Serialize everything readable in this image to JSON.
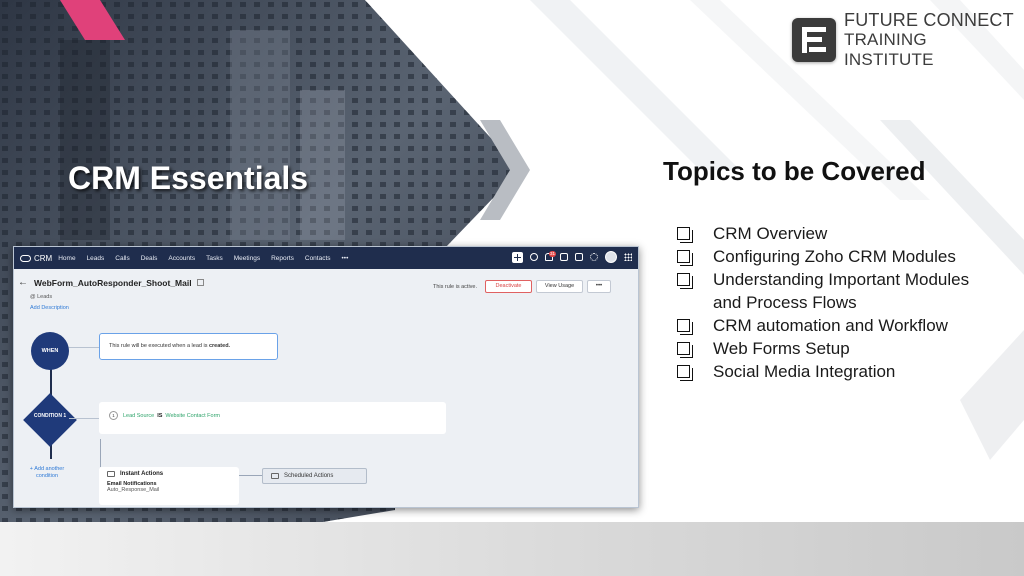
{
  "logo": {
    "line1": "FUTURE CONNECT",
    "line2": "TRAINING INSTITUTE"
  },
  "slide": {
    "title": "CRM Essentials",
    "topics_title": "Topics to be Covered",
    "topics": [
      "CRM Overview",
      "Configuring Zoho CRM Modules",
      "Understanding Important Modules and Process Flows",
      "CRM automation and Workflow",
      "Web Forms Setup",
      "Social Media Integration"
    ]
  },
  "crm": {
    "brand": "CRM",
    "nav": [
      "Home",
      "Leads",
      "Calls",
      "Deals",
      "Accounts",
      "Tasks",
      "Meetings",
      "Reports",
      "Contacts",
      "•••"
    ],
    "notification_count": "31",
    "rule_name": "WebForm_AutoResponder_Shoot_Mail",
    "module": "@ Leads",
    "add_description": "Add Description",
    "status_text": "This rule is active.",
    "deactivate_label": "Deactivate",
    "view_usage_label": "View Usage",
    "more_label": "•••",
    "when_label": "WHEN",
    "when_text": "This rule will be executed when a lead is",
    "when_event": "created.",
    "condition_label": "CONDITION 1",
    "condition_number": "1",
    "condition_field": "Lead Source",
    "condition_operator": "IS",
    "condition_value": "Website Contact Form",
    "add_condition": "+ Add another condition",
    "instant_actions": "Instant Actions",
    "email_notifications": "Email Notifications",
    "email_template": "Auto_Response_Mail",
    "scheduled_actions": "Scheduled Actions"
  }
}
